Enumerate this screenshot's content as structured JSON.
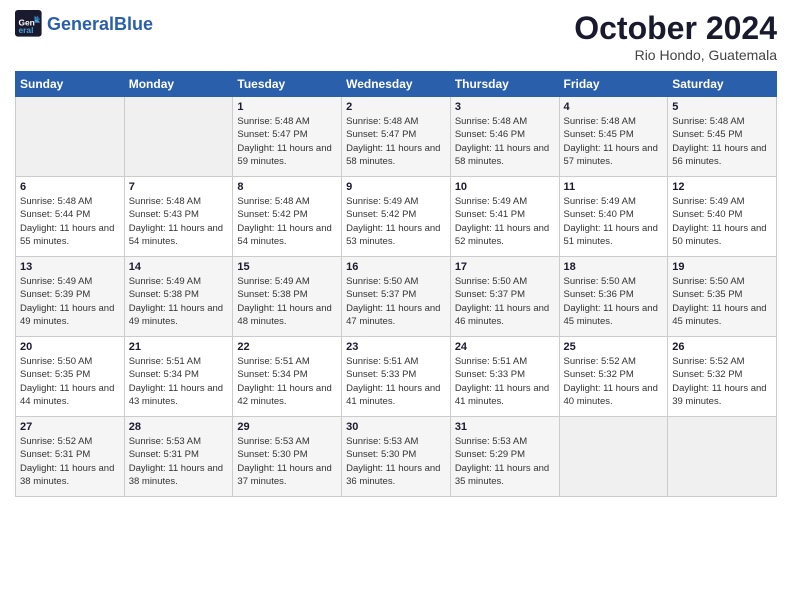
{
  "logo": {
    "text_general": "General",
    "text_blue": "Blue"
  },
  "header": {
    "month": "October 2024",
    "location": "Rio Hondo, Guatemala"
  },
  "weekdays": [
    "Sunday",
    "Monday",
    "Tuesday",
    "Wednesday",
    "Thursday",
    "Friday",
    "Saturday"
  ],
  "weeks": [
    [
      {
        "day": "",
        "sunrise": "",
        "sunset": "",
        "daylight": ""
      },
      {
        "day": "",
        "sunrise": "",
        "sunset": "",
        "daylight": ""
      },
      {
        "day": "1",
        "sunrise": "Sunrise: 5:48 AM",
        "sunset": "Sunset: 5:47 PM",
        "daylight": "Daylight: 11 hours and 59 minutes."
      },
      {
        "day": "2",
        "sunrise": "Sunrise: 5:48 AM",
        "sunset": "Sunset: 5:47 PM",
        "daylight": "Daylight: 11 hours and 58 minutes."
      },
      {
        "day": "3",
        "sunrise": "Sunrise: 5:48 AM",
        "sunset": "Sunset: 5:46 PM",
        "daylight": "Daylight: 11 hours and 58 minutes."
      },
      {
        "day": "4",
        "sunrise": "Sunrise: 5:48 AM",
        "sunset": "Sunset: 5:45 PM",
        "daylight": "Daylight: 11 hours and 57 minutes."
      },
      {
        "day": "5",
        "sunrise": "Sunrise: 5:48 AM",
        "sunset": "Sunset: 5:45 PM",
        "daylight": "Daylight: 11 hours and 56 minutes."
      }
    ],
    [
      {
        "day": "6",
        "sunrise": "Sunrise: 5:48 AM",
        "sunset": "Sunset: 5:44 PM",
        "daylight": "Daylight: 11 hours and 55 minutes."
      },
      {
        "day": "7",
        "sunrise": "Sunrise: 5:48 AM",
        "sunset": "Sunset: 5:43 PM",
        "daylight": "Daylight: 11 hours and 54 minutes."
      },
      {
        "day": "8",
        "sunrise": "Sunrise: 5:48 AM",
        "sunset": "Sunset: 5:42 PM",
        "daylight": "Daylight: 11 hours and 54 minutes."
      },
      {
        "day": "9",
        "sunrise": "Sunrise: 5:49 AM",
        "sunset": "Sunset: 5:42 PM",
        "daylight": "Daylight: 11 hours and 53 minutes."
      },
      {
        "day": "10",
        "sunrise": "Sunrise: 5:49 AM",
        "sunset": "Sunset: 5:41 PM",
        "daylight": "Daylight: 11 hours and 52 minutes."
      },
      {
        "day": "11",
        "sunrise": "Sunrise: 5:49 AM",
        "sunset": "Sunset: 5:40 PM",
        "daylight": "Daylight: 11 hours and 51 minutes."
      },
      {
        "day": "12",
        "sunrise": "Sunrise: 5:49 AM",
        "sunset": "Sunset: 5:40 PM",
        "daylight": "Daylight: 11 hours and 50 minutes."
      }
    ],
    [
      {
        "day": "13",
        "sunrise": "Sunrise: 5:49 AM",
        "sunset": "Sunset: 5:39 PM",
        "daylight": "Daylight: 11 hours and 49 minutes."
      },
      {
        "day": "14",
        "sunrise": "Sunrise: 5:49 AM",
        "sunset": "Sunset: 5:38 PM",
        "daylight": "Daylight: 11 hours and 49 minutes."
      },
      {
        "day": "15",
        "sunrise": "Sunrise: 5:49 AM",
        "sunset": "Sunset: 5:38 PM",
        "daylight": "Daylight: 11 hours and 48 minutes."
      },
      {
        "day": "16",
        "sunrise": "Sunrise: 5:50 AM",
        "sunset": "Sunset: 5:37 PM",
        "daylight": "Daylight: 11 hours and 47 minutes."
      },
      {
        "day": "17",
        "sunrise": "Sunrise: 5:50 AM",
        "sunset": "Sunset: 5:37 PM",
        "daylight": "Daylight: 11 hours and 46 minutes."
      },
      {
        "day": "18",
        "sunrise": "Sunrise: 5:50 AM",
        "sunset": "Sunset: 5:36 PM",
        "daylight": "Daylight: 11 hours and 45 minutes."
      },
      {
        "day": "19",
        "sunrise": "Sunrise: 5:50 AM",
        "sunset": "Sunset: 5:35 PM",
        "daylight": "Daylight: 11 hours and 45 minutes."
      }
    ],
    [
      {
        "day": "20",
        "sunrise": "Sunrise: 5:50 AM",
        "sunset": "Sunset: 5:35 PM",
        "daylight": "Daylight: 11 hours and 44 minutes."
      },
      {
        "day": "21",
        "sunrise": "Sunrise: 5:51 AM",
        "sunset": "Sunset: 5:34 PM",
        "daylight": "Daylight: 11 hours and 43 minutes."
      },
      {
        "day": "22",
        "sunrise": "Sunrise: 5:51 AM",
        "sunset": "Sunset: 5:34 PM",
        "daylight": "Daylight: 11 hours and 42 minutes."
      },
      {
        "day": "23",
        "sunrise": "Sunrise: 5:51 AM",
        "sunset": "Sunset: 5:33 PM",
        "daylight": "Daylight: 11 hours and 41 minutes."
      },
      {
        "day": "24",
        "sunrise": "Sunrise: 5:51 AM",
        "sunset": "Sunset: 5:33 PM",
        "daylight": "Daylight: 11 hours and 41 minutes."
      },
      {
        "day": "25",
        "sunrise": "Sunrise: 5:52 AM",
        "sunset": "Sunset: 5:32 PM",
        "daylight": "Daylight: 11 hours and 40 minutes."
      },
      {
        "day": "26",
        "sunrise": "Sunrise: 5:52 AM",
        "sunset": "Sunset: 5:32 PM",
        "daylight": "Daylight: 11 hours and 39 minutes."
      }
    ],
    [
      {
        "day": "27",
        "sunrise": "Sunrise: 5:52 AM",
        "sunset": "Sunset: 5:31 PM",
        "daylight": "Daylight: 11 hours and 38 minutes."
      },
      {
        "day": "28",
        "sunrise": "Sunrise: 5:53 AM",
        "sunset": "Sunset: 5:31 PM",
        "daylight": "Daylight: 11 hours and 38 minutes."
      },
      {
        "day": "29",
        "sunrise": "Sunrise: 5:53 AM",
        "sunset": "Sunset: 5:30 PM",
        "daylight": "Daylight: 11 hours and 37 minutes."
      },
      {
        "day": "30",
        "sunrise": "Sunrise: 5:53 AM",
        "sunset": "Sunset: 5:30 PM",
        "daylight": "Daylight: 11 hours and 36 minutes."
      },
      {
        "day": "31",
        "sunrise": "Sunrise: 5:53 AM",
        "sunset": "Sunset: 5:29 PM",
        "daylight": "Daylight: 11 hours and 35 minutes."
      },
      {
        "day": "",
        "sunrise": "",
        "sunset": "",
        "daylight": ""
      },
      {
        "day": "",
        "sunrise": "",
        "sunset": "",
        "daylight": ""
      }
    ]
  ]
}
